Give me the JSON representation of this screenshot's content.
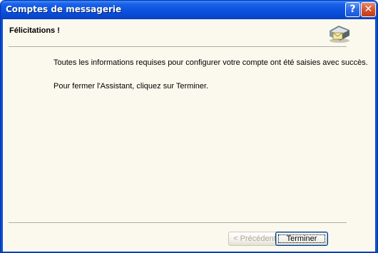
{
  "window": {
    "title": "Comptes de messagerie",
    "help_glyph": "?",
    "close_glyph": "✕"
  },
  "header": {
    "title": "Félicitations !",
    "icon": "mail-account-icon"
  },
  "body": {
    "line1": "Toutes les informations requises pour configurer votre compte ont été saisies avec succès.",
    "line2": "Pour fermer l'Assistant, cliquez sur Terminer."
  },
  "buttons": {
    "previous": "< Précédent",
    "finish": "Terminer"
  },
  "colors": {
    "titlebar": "#0a52de",
    "client_background": "#fbf9ed",
    "close_button": "#d4542d"
  }
}
